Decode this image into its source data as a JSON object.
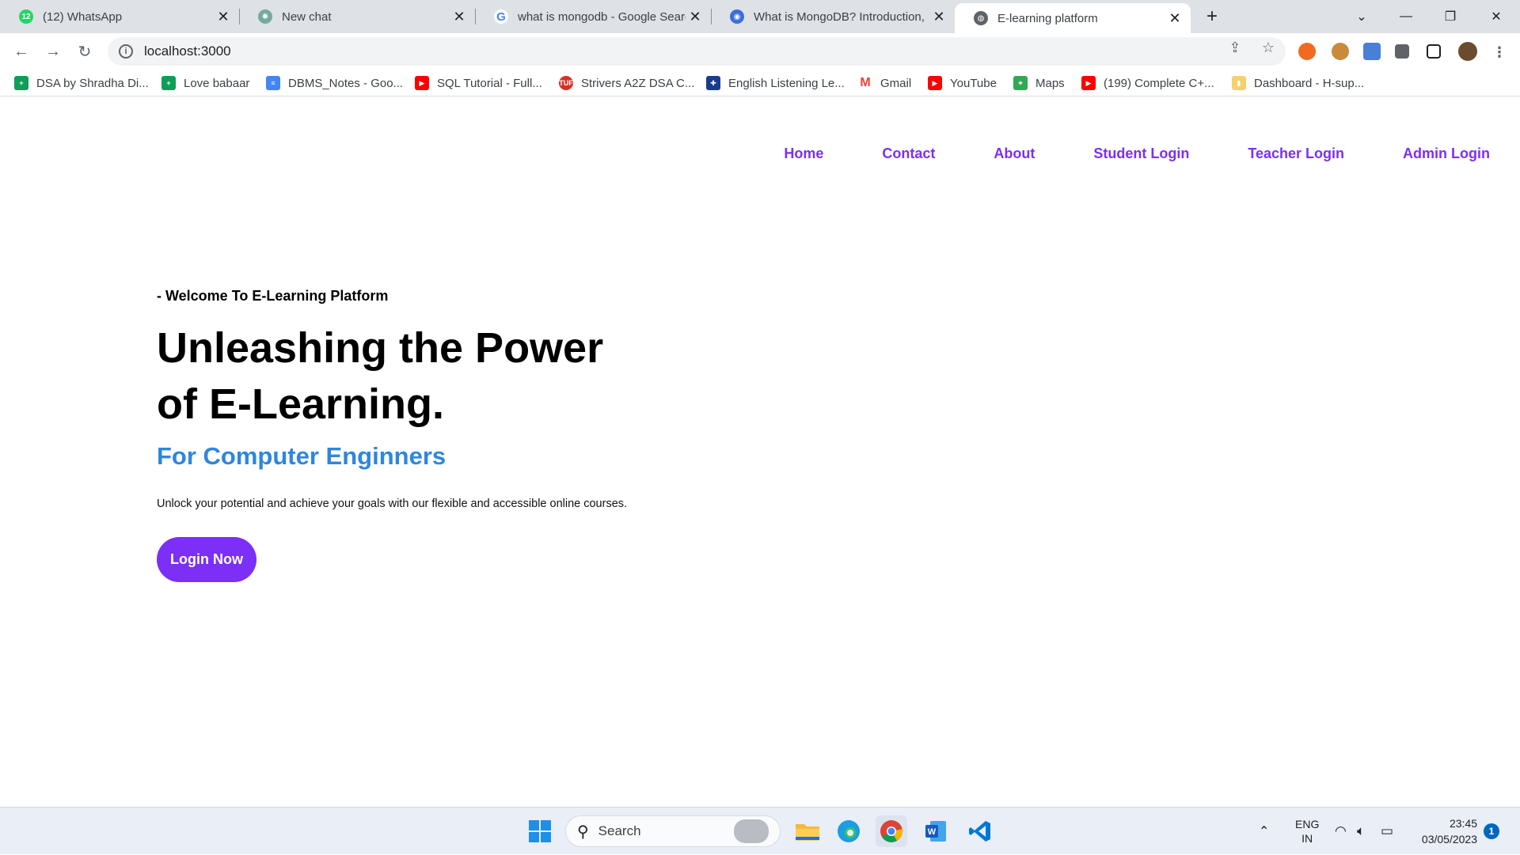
{
  "browser": {
    "tabs": [
      {
        "title": "(12) WhatsApp",
        "favicon": "whatsapp-icon",
        "badge": "12"
      },
      {
        "title": "New chat",
        "favicon": "chatgpt-icon"
      },
      {
        "title": "what is mongodb - Google Searc",
        "favicon": "google-icon"
      },
      {
        "title": "What is MongoDB? Introduction,",
        "favicon": "web-icon"
      },
      {
        "title": "E-learning platform",
        "favicon": "globe-icon",
        "active": true
      }
    ],
    "address": "localhost:3000",
    "bookmarks": [
      {
        "label": "DSA by Shradha Di...",
        "icon": "sheets-icon",
        "color": "#0f9d58"
      },
      {
        "label": "Love babaar",
        "icon": "sheets-icon",
        "color": "#0f9d58"
      },
      {
        "label": "DBMS_Notes - Goo...",
        "icon": "docs-icon",
        "color": "#4285f4"
      },
      {
        "label": "SQL Tutorial - Full...",
        "icon": "youtube-icon",
        "color": "#ff0000"
      },
      {
        "label": "Strivers A2Z DSA C...",
        "icon": "tuf-icon",
        "color": "#d93025"
      },
      {
        "label": "English Listening Le...",
        "icon": "uk-flag-icon",
        "color": "#1a3c8f"
      },
      {
        "label": "Gmail",
        "icon": "gmail-icon",
        "color": "#ea4335"
      },
      {
        "label": "YouTube",
        "icon": "youtube-icon",
        "color": "#ff0000"
      },
      {
        "label": "Maps",
        "icon": "maps-icon",
        "color": "#34a853"
      },
      {
        "label": "(199) Complete C+...",
        "icon": "youtube-icon",
        "color": "#ff0000"
      },
      {
        "label": "Dashboard - H-sup...",
        "icon": "dashboard-icon",
        "color": "#f6d16b"
      }
    ]
  },
  "site": {
    "nav": [
      "Home",
      "Contact",
      "About",
      "Student Login",
      "Teacher Login",
      "Admin Login"
    ],
    "kicker": "- Welcome To E-Learning Platform",
    "headline": "Unleashing the Power of E-Learning.",
    "subhead": "For Computer Enginners",
    "description": "Unlock your potential and achieve your goals with our flexible and accessible online courses.",
    "cta": "Login Now",
    "accent": "#7b2ff7",
    "subhead_color": "#2e86de"
  },
  "taskbar": {
    "search_placeholder": "Search",
    "lang_line1": "ENG",
    "lang_line2": "IN",
    "time": "23:45",
    "date": "03/05/2023",
    "notification_count": "1"
  }
}
